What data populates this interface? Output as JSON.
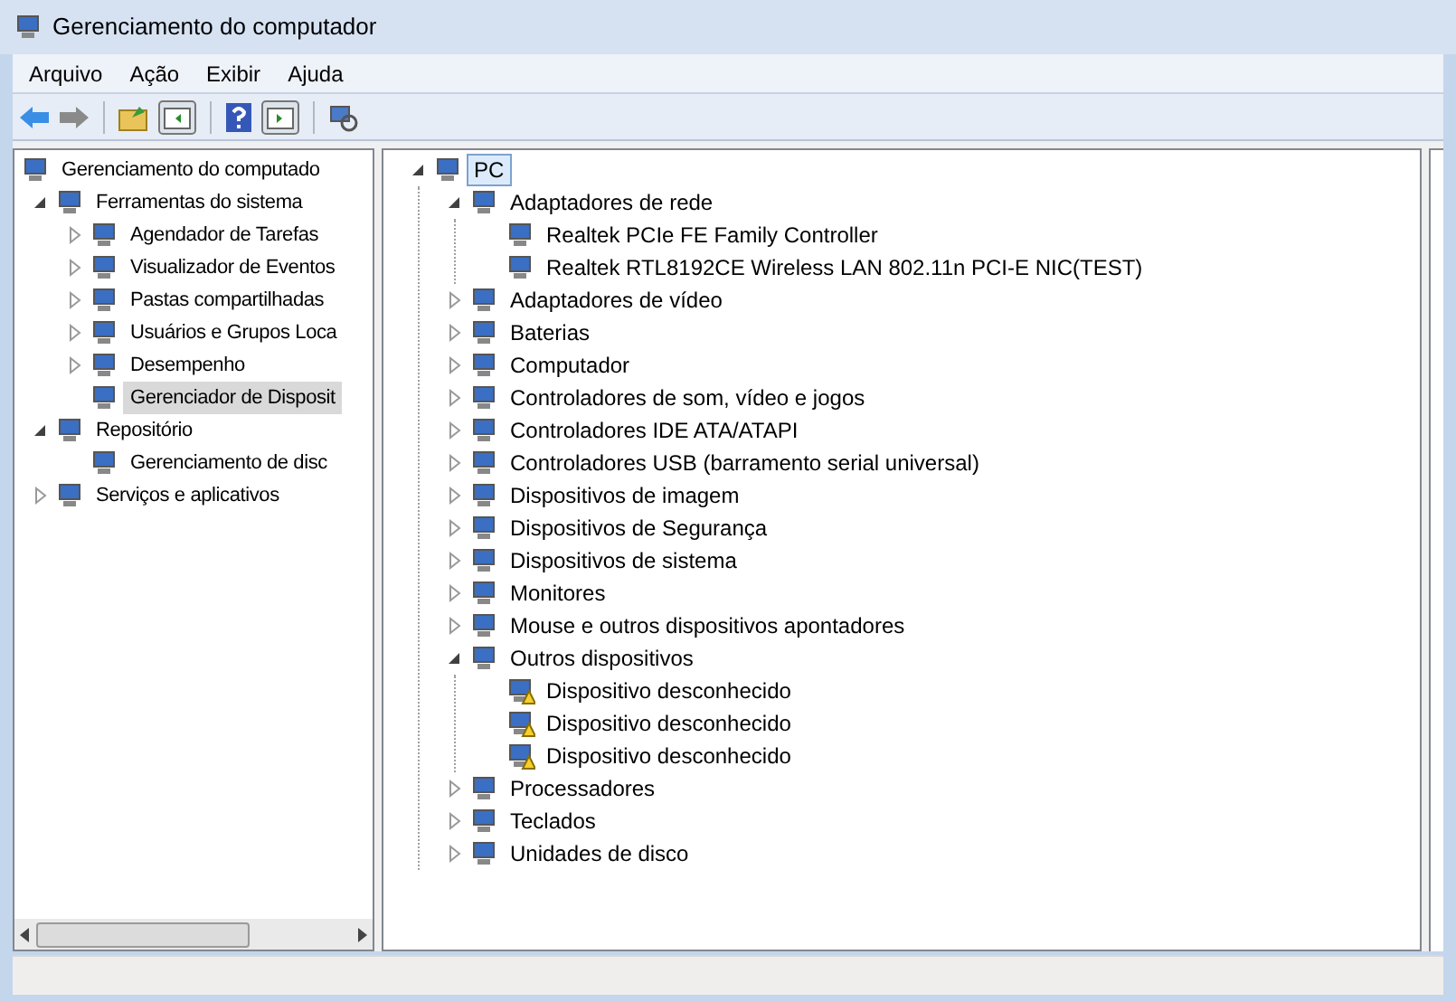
{
  "window": {
    "title": "Gerenciamento do computador"
  },
  "menu": [
    "Arquivo",
    "Ação",
    "Exibir",
    "Ajuda"
  ],
  "left_tree": [
    {
      "label": "Gerenciamento do computado",
      "selected": false,
      "children": [
        {
          "label": "Ferramentas do sistema",
          "expanded": true,
          "selected": false,
          "children": [
            {
              "label": "Agendador de Tarefas",
              "expanded": false,
              "selected": false
            },
            {
              "label": "Visualizador de Eventos",
              "expanded": false,
              "selected": false
            },
            {
              "label": "Pastas compartilhadas",
              "expanded": false,
              "selected": false
            },
            {
              "label": "Usuários e Grupos Loca",
              "expanded": false,
              "selected": false
            },
            {
              "label": "Desempenho",
              "expanded": false,
              "selected": false
            },
            {
              "label": "Gerenciador de Disposit",
              "selected": true
            }
          ]
        },
        {
          "label": "Repositório",
          "expanded": true,
          "selected": false,
          "children": [
            {
              "label": "Gerenciamento de disc",
              "selected": false
            }
          ]
        },
        {
          "label": "Serviços e aplicativos",
          "expanded": false,
          "selected": false
        }
      ]
    }
  ],
  "device_tree": [
    {
      "label": "PC",
      "expanded": true,
      "selected": true,
      "children": [
        {
          "label": "Adaptadores de rede",
          "expanded": true,
          "selected": false,
          "children": [
            {
              "label": "Realtek PCIe FE Family Controller",
              "selected": false,
              "warning": false
            },
            {
              "label": "Realtek RTL8192CE Wireless LAN 802.11n PCI-E NIC(TEST)",
              "selected": false,
              "warning": false
            }
          ]
        },
        {
          "label": "Adaptadores de vídeo",
          "expanded": false,
          "selected": false
        },
        {
          "label": "Baterias",
          "expanded": false,
          "selected": false
        },
        {
          "label": "Computador",
          "expanded": false,
          "selected": false
        },
        {
          "label": "Controladores de som, vídeo e jogos",
          "expanded": false,
          "selected": false
        },
        {
          "label": "Controladores IDE ATA/ATAPI",
          "expanded": false,
          "selected": false
        },
        {
          "label": "Controladores USB (barramento serial universal)",
          "expanded": false,
          "selected": false
        },
        {
          "label": "Dispositivos de imagem",
          "expanded": false,
          "selected": false
        },
        {
          "label": "Dispositivos de Segurança",
          "expanded": false,
          "selected": false
        },
        {
          "label": "Dispositivos de sistema",
          "expanded": false,
          "selected": false
        },
        {
          "label": "Monitores",
          "expanded": false,
          "selected": false
        },
        {
          "label": "Mouse e outros dispositivos apontadores",
          "expanded": false,
          "selected": false
        },
        {
          "label": "Outros dispositivos",
          "expanded": true,
          "selected": false,
          "children": [
            {
              "label": "Dispositivo desconhecido",
              "selected": false,
              "warning": true
            },
            {
              "label": "Dispositivo desconhecido",
              "selected": false,
              "warning": true
            },
            {
              "label": "Dispositivo desconhecido",
              "selected": false,
              "warning": true
            }
          ]
        },
        {
          "label": "Processadores",
          "expanded": false,
          "selected": false
        },
        {
          "label": "Teclados",
          "expanded": false,
          "selected": false
        },
        {
          "label": "Unidades de disco",
          "expanded": false,
          "selected": false
        }
      ]
    }
  ]
}
